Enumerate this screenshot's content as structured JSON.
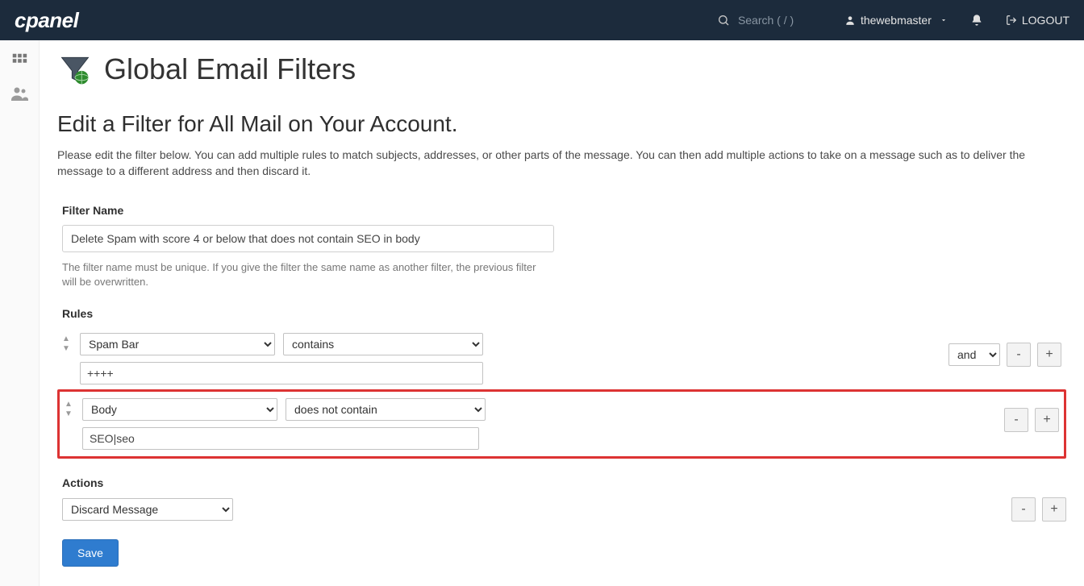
{
  "header": {
    "logo_text": "cPanel",
    "search_placeholder": "Search ( / )",
    "username": "thewebmaster",
    "logout_label": "LOGOUT"
  },
  "page": {
    "title": "Global Email Filters",
    "subhead": "Edit a Filter for All Mail on Your Account.",
    "intro": "Please edit the filter below. You can add multiple rules to match subjects, addresses, or other parts of the message. You can then add multiple actions to take on a message such as to deliver the message to a different address and then discard it."
  },
  "filter_name": {
    "label": "Filter Name",
    "value": "Delete Spam with score 4 or below that does not contain SEO in body",
    "help": "The filter name must be unique. If you give the filter the same name as another filter, the previous filter will be overwritten."
  },
  "rules": {
    "label": "Rules",
    "items": [
      {
        "field": "Spam Bar",
        "operator": "contains",
        "value": "++++",
        "logic": "and",
        "show_logic": true,
        "highlighted": false
      },
      {
        "field": "Body",
        "operator": "does not contain",
        "value": "SEO|seo",
        "logic": "",
        "show_logic": false,
        "highlighted": true
      }
    ]
  },
  "actions": {
    "label": "Actions",
    "value": "Discard Message"
  },
  "buttons": {
    "save": "Save",
    "minus": "-",
    "plus": "+"
  }
}
